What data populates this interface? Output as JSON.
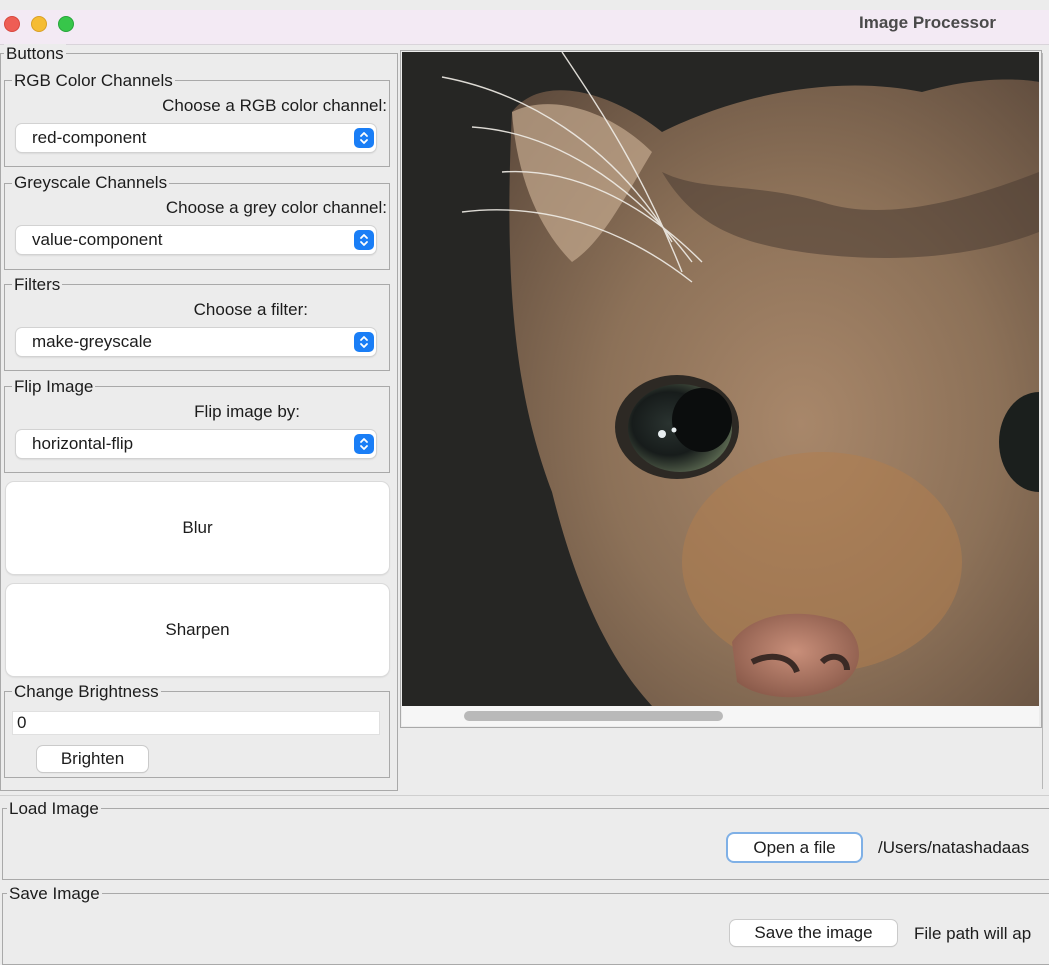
{
  "window": {
    "title": "Image Processor"
  },
  "buttons_panel": {
    "legend": "Buttons",
    "rgb": {
      "legend": "RGB Color Channels",
      "prompt": "Choose a RGB color channel:",
      "selected": "red-component"
    },
    "grey": {
      "legend": "Greyscale Channels",
      "prompt": "Choose a grey color channel:",
      "selected": "value-component"
    },
    "filters": {
      "legend": "Filters",
      "prompt": "Choose a filter:",
      "selected": "make-greyscale"
    },
    "flip": {
      "legend": "Flip Image",
      "prompt": "Flip image by:",
      "selected": "horizontal-flip"
    },
    "blur_label": "Blur",
    "sharpen_label": "Sharpen",
    "brightness": {
      "legend": "Change Brightness",
      "value": "0",
      "button_label": "Brighten"
    }
  },
  "load": {
    "legend": "Load Image",
    "button_label": "Open a file",
    "path_text": "/Users/natashadaas"
  },
  "save": {
    "legend": "Save Image",
    "button_label": "Save the image",
    "path_text": "File path will ap"
  },
  "colors": {
    "accent": "#1a7ef6",
    "titlebar": "#f3eaf4",
    "window_bg": "#ececec"
  }
}
